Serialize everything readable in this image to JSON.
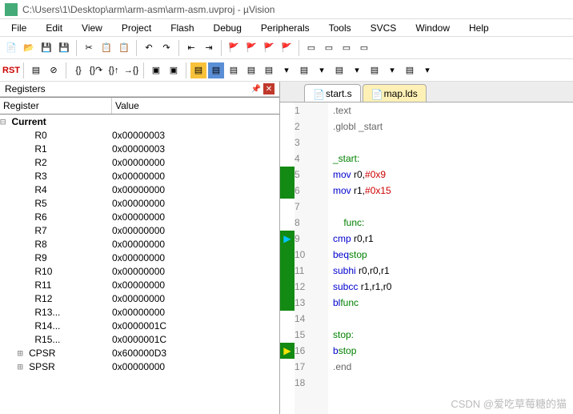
{
  "title": "C:\\Users\\1\\Desktop\\arm\\arm-asm\\arm-asm.uvproj - µVision",
  "menu": [
    "File",
    "Edit",
    "View",
    "Project",
    "Flash",
    "Debug",
    "Peripherals",
    "Tools",
    "SVCS",
    "Window",
    "Help"
  ],
  "panel": {
    "title": "Registers",
    "headers": {
      "reg": "Register",
      "val": "Value"
    },
    "group": "Current",
    "rows": [
      {
        "n": "R0",
        "v": "0x00000003"
      },
      {
        "n": "R1",
        "v": "0x00000003"
      },
      {
        "n": "R2",
        "v": "0x00000000"
      },
      {
        "n": "R3",
        "v": "0x00000000"
      },
      {
        "n": "R4",
        "v": "0x00000000"
      },
      {
        "n": "R5",
        "v": "0x00000000"
      },
      {
        "n": "R6",
        "v": "0x00000000"
      },
      {
        "n": "R7",
        "v": "0x00000000"
      },
      {
        "n": "R8",
        "v": "0x00000000"
      },
      {
        "n": "R9",
        "v": "0x00000000"
      },
      {
        "n": "R10",
        "v": "0x00000000"
      },
      {
        "n": "R11",
        "v": "0x00000000"
      },
      {
        "n": "R12",
        "v": "0x00000000"
      },
      {
        "n": "R13...",
        "v": "0x00000000"
      },
      {
        "n": "R14...",
        "v": "0x0000001C"
      },
      {
        "n": "R15...",
        "v": "0x0000001C"
      },
      {
        "n": "CPSR",
        "v": "0x600000D3",
        "exp": true
      },
      {
        "n": "SPSR",
        "v": "0x00000000",
        "exp": true
      }
    ]
  },
  "tabs": [
    {
      "label": "start.s",
      "active": true
    },
    {
      "label": "map.lds",
      "active": false
    }
  ],
  "code": [
    {
      "ln": 1,
      "t": ".text",
      "cls": "dir"
    },
    {
      "ln": 2,
      "t": ".globl _start",
      "cls": "dir"
    },
    {
      "ln": 3,
      "t": ""
    },
    {
      "ln": 4,
      "t": "_start:",
      "cls": "label"
    },
    {
      "ln": 5,
      "t": "    mov r0,#0x9",
      "cls": "op",
      "m": "green"
    },
    {
      "ln": 6,
      "t": "    mov r1,#0x15",
      "cls": "op",
      "m": "green"
    },
    {
      "ln": 7,
      "t": ""
    },
    {
      "ln": 8,
      "t": "    func:",
      "cls": "label"
    },
    {
      "ln": 9,
      "t": "    cmp r0,r1",
      "cls": "op",
      "m": "arrow"
    },
    {
      "ln": 10,
      "t": "    beq stop",
      "cls": "op",
      "m": "green"
    },
    {
      "ln": 11,
      "t": "    subhi r0,r0,r1",
      "cls": "op",
      "m": "green"
    },
    {
      "ln": 12,
      "t": "    subcc r1,r1,r0",
      "cls": "op",
      "m": "green"
    },
    {
      "ln": 13,
      "t": "    bl  func",
      "cls": "op",
      "m": "green"
    },
    {
      "ln": 14,
      "t": ""
    },
    {
      "ln": 15,
      "t": "stop:",
      "cls": "label"
    },
    {
      "ln": 16,
      "t": "    b stop",
      "cls": "op",
      "m": "yarrow"
    },
    {
      "ln": 17,
      "t": ".end",
      "cls": "dir"
    },
    {
      "ln": 18,
      "t": ""
    }
  ],
  "watermark": "CSDN @爱吃草莓糖的猫"
}
